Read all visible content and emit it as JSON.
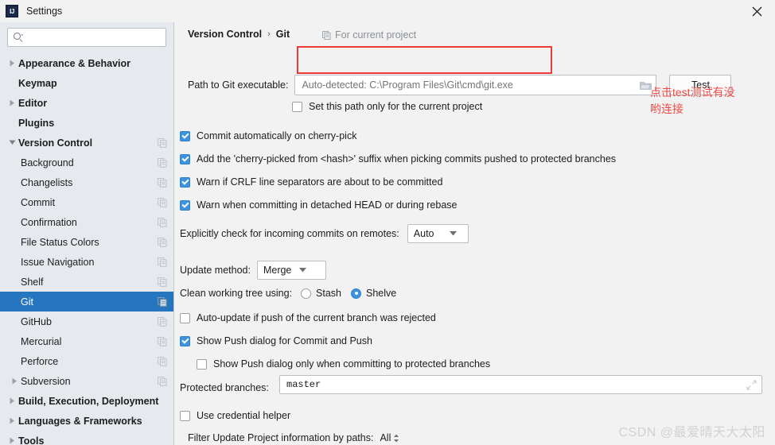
{
  "window": {
    "title": "Settings",
    "logo_text": "IJ",
    "close_label": "✕"
  },
  "sidebar": {
    "search": {
      "value": "",
      "placeholder": ""
    },
    "items": [
      {
        "label": "Appearance & Behavior",
        "level": 0,
        "arrow": "right",
        "bold": true,
        "copy": false,
        "selected": false
      },
      {
        "label": "Keymap",
        "level": 0,
        "arrow": "none",
        "bold": true,
        "copy": false,
        "selected": false
      },
      {
        "label": "Editor",
        "level": 0,
        "arrow": "right",
        "bold": true,
        "copy": false,
        "selected": false
      },
      {
        "label": "Plugins",
        "level": 0,
        "arrow": "none",
        "bold": true,
        "copy": false,
        "selected": false
      },
      {
        "label": "Version Control",
        "level": 0,
        "arrow": "down",
        "bold": true,
        "copy": true,
        "selected": false
      },
      {
        "label": "Background",
        "level": 1,
        "arrow": "none",
        "bold": false,
        "copy": true,
        "selected": false
      },
      {
        "label": "Changelists",
        "level": 1,
        "arrow": "none",
        "bold": false,
        "copy": true,
        "selected": false
      },
      {
        "label": "Commit",
        "level": 1,
        "arrow": "none",
        "bold": false,
        "copy": true,
        "selected": false
      },
      {
        "label": "Confirmation",
        "level": 1,
        "arrow": "none",
        "bold": false,
        "copy": true,
        "selected": false
      },
      {
        "label": "File Status Colors",
        "level": 1,
        "arrow": "none",
        "bold": false,
        "copy": true,
        "selected": false
      },
      {
        "label": "Issue Navigation",
        "level": 1,
        "arrow": "none",
        "bold": false,
        "copy": true,
        "selected": false
      },
      {
        "label": "Shelf",
        "level": 1,
        "arrow": "none",
        "bold": false,
        "copy": true,
        "selected": false
      },
      {
        "label": "Git",
        "level": 1,
        "arrow": "none",
        "bold": false,
        "copy": true,
        "selected": true
      },
      {
        "label": "GitHub",
        "level": 1,
        "arrow": "none",
        "bold": false,
        "copy": true,
        "selected": false
      },
      {
        "label": "Mercurial",
        "level": 1,
        "arrow": "none",
        "bold": false,
        "copy": true,
        "selected": false
      },
      {
        "label": "Perforce",
        "level": 1,
        "arrow": "none",
        "bold": false,
        "copy": true,
        "selected": false
      },
      {
        "label": "Subversion",
        "level": 1,
        "arrow": "right",
        "bold": false,
        "copy": true,
        "selected": false
      },
      {
        "label": "Build, Execution, Deployment",
        "level": 0,
        "arrow": "right",
        "bold": true,
        "copy": false,
        "selected": false
      },
      {
        "label": "Languages & Frameworks",
        "level": 0,
        "arrow": "right",
        "bold": true,
        "copy": false,
        "selected": false
      },
      {
        "label": "Tools",
        "level": 0,
        "arrow": "right",
        "bold": true,
        "copy": false,
        "selected": false
      }
    ]
  },
  "main": {
    "breadcrumb": {
      "parent": "Version Control",
      "separator": "›",
      "current": "Git"
    },
    "for_current_project": "For current project",
    "path_label": "Path to Git executable:",
    "path_value": "",
    "path_placeholder": "Auto-detected: C:\\Program Files\\Git\\cmd\\git.exe",
    "test_button": "Test",
    "set_path_only": "Set this path only for the current project",
    "checkboxes": [
      {
        "label": "Commit automatically on cherry-pick",
        "checked": true
      },
      {
        "label": "Add the 'cherry-picked from <hash>' suffix when picking commits pushed to protected branches",
        "checked": true
      },
      {
        "label": "Warn if CRLF line separators are about to be committed",
        "checked": true
      },
      {
        "label": "Warn when committing in detached HEAD or during rebase",
        "checked": true
      }
    ],
    "incoming_label": "Explicitly check for incoming commits on remotes:",
    "incoming_value": "Auto",
    "update_method_label": "Update method:",
    "update_method_value": "Merge",
    "clean_tree_label": "Clean working tree using:",
    "clean_tree_option_stash": "Stash",
    "clean_tree_option_shelve": "Shelve",
    "clean_tree_selected": "Shelve",
    "auto_update_label": "Auto-update if push of the current branch was rejected",
    "auto_update_checked": false,
    "show_push_label": "Show Push dialog for Commit and Push",
    "show_push_checked": true,
    "show_push_protected_label": "Show Push dialog only when committing to protected branches",
    "show_push_protected_checked": false,
    "protected_branches_label": "Protected branches:",
    "protected_branches_value": "master",
    "use_credential_label": "Use credential helper",
    "use_credential_checked": false,
    "filter_label": "Filter Update Project information by paths:",
    "filter_value": "All"
  },
  "annotation": {
    "note_line1": "点击test测试有没",
    "note_line2": "哟连接",
    "box_color": "#ef3b36",
    "text_color": "#f04a46"
  },
  "watermark": "CSDN @最爱晴天大太阳"
}
